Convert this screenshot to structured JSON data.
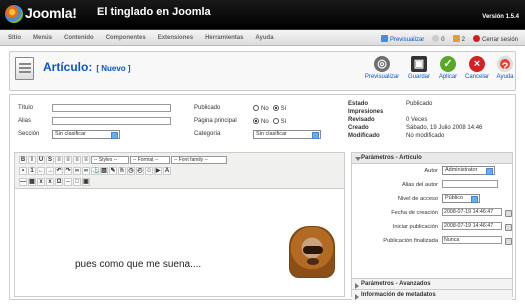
{
  "header": {
    "app": "Joomla!",
    "site": "El tinglado en Joomla",
    "version": "Versión 1.5.4"
  },
  "menu": [
    "Sitio",
    "Menús",
    "Contenido",
    "Componentes",
    "Extensiones",
    "Herramientas",
    "Ayuda"
  ],
  "status": {
    "preview": "Previsualizar",
    "messages": "0",
    "users": "2",
    "logout": "Cerrar sesión"
  },
  "page": {
    "title": "Artículo:",
    "subtitle": "[ Nuevo ]"
  },
  "toolbar": {
    "preview": "Previsualizar",
    "save": "Guardar",
    "apply": "Aplicar",
    "cancel": "Cancelar",
    "help": "Ayuda"
  },
  "form": {
    "title": "Título",
    "alias": "Alias",
    "section": "Sección",
    "published": "Publicado",
    "frontpage": "Página principal",
    "category": "Categoría",
    "no": "No",
    "yes": "Sí",
    "section_value": "Sin clasificar",
    "category_value": "Sin clasificar"
  },
  "info": [
    {
      "label": "Estado",
      "value": "Publicado"
    },
    {
      "label": "Impresiones",
      "value": ""
    },
    {
      "label": "Revisado",
      "value": "0 Veces"
    },
    {
      "label": "Creado",
      "value": "Sábado, 19 Julio 2008 14:46"
    },
    {
      "label": "Modificado",
      "value": "No modificado"
    }
  ],
  "editor": {
    "styles": "-- Styles --",
    "format": "-- Format --",
    "font": "-- Font family --",
    "content": "pues como que me suena...."
  },
  "params": {
    "title": "Parámetros - Artículo",
    "author_label": "Autor",
    "author_value": "Administrator",
    "alias_label": "Alias del autor",
    "access_label": "Nivel de acceso",
    "access_value": "Público",
    "created_label": "Fecha de creación",
    "created_value": "2008-07-19 14:46:47",
    "start_label": "Iniciar publicación",
    "start_value": "2008-07-19 14:46:47",
    "finish_label": "Publicación finalizada",
    "finish_value": "Nunca",
    "advanced": "Parámetros - Avanzados",
    "metadata": "Información de metadatos"
  },
  "colors": {
    "accent": "#0b55c4",
    "header": "#000000"
  }
}
